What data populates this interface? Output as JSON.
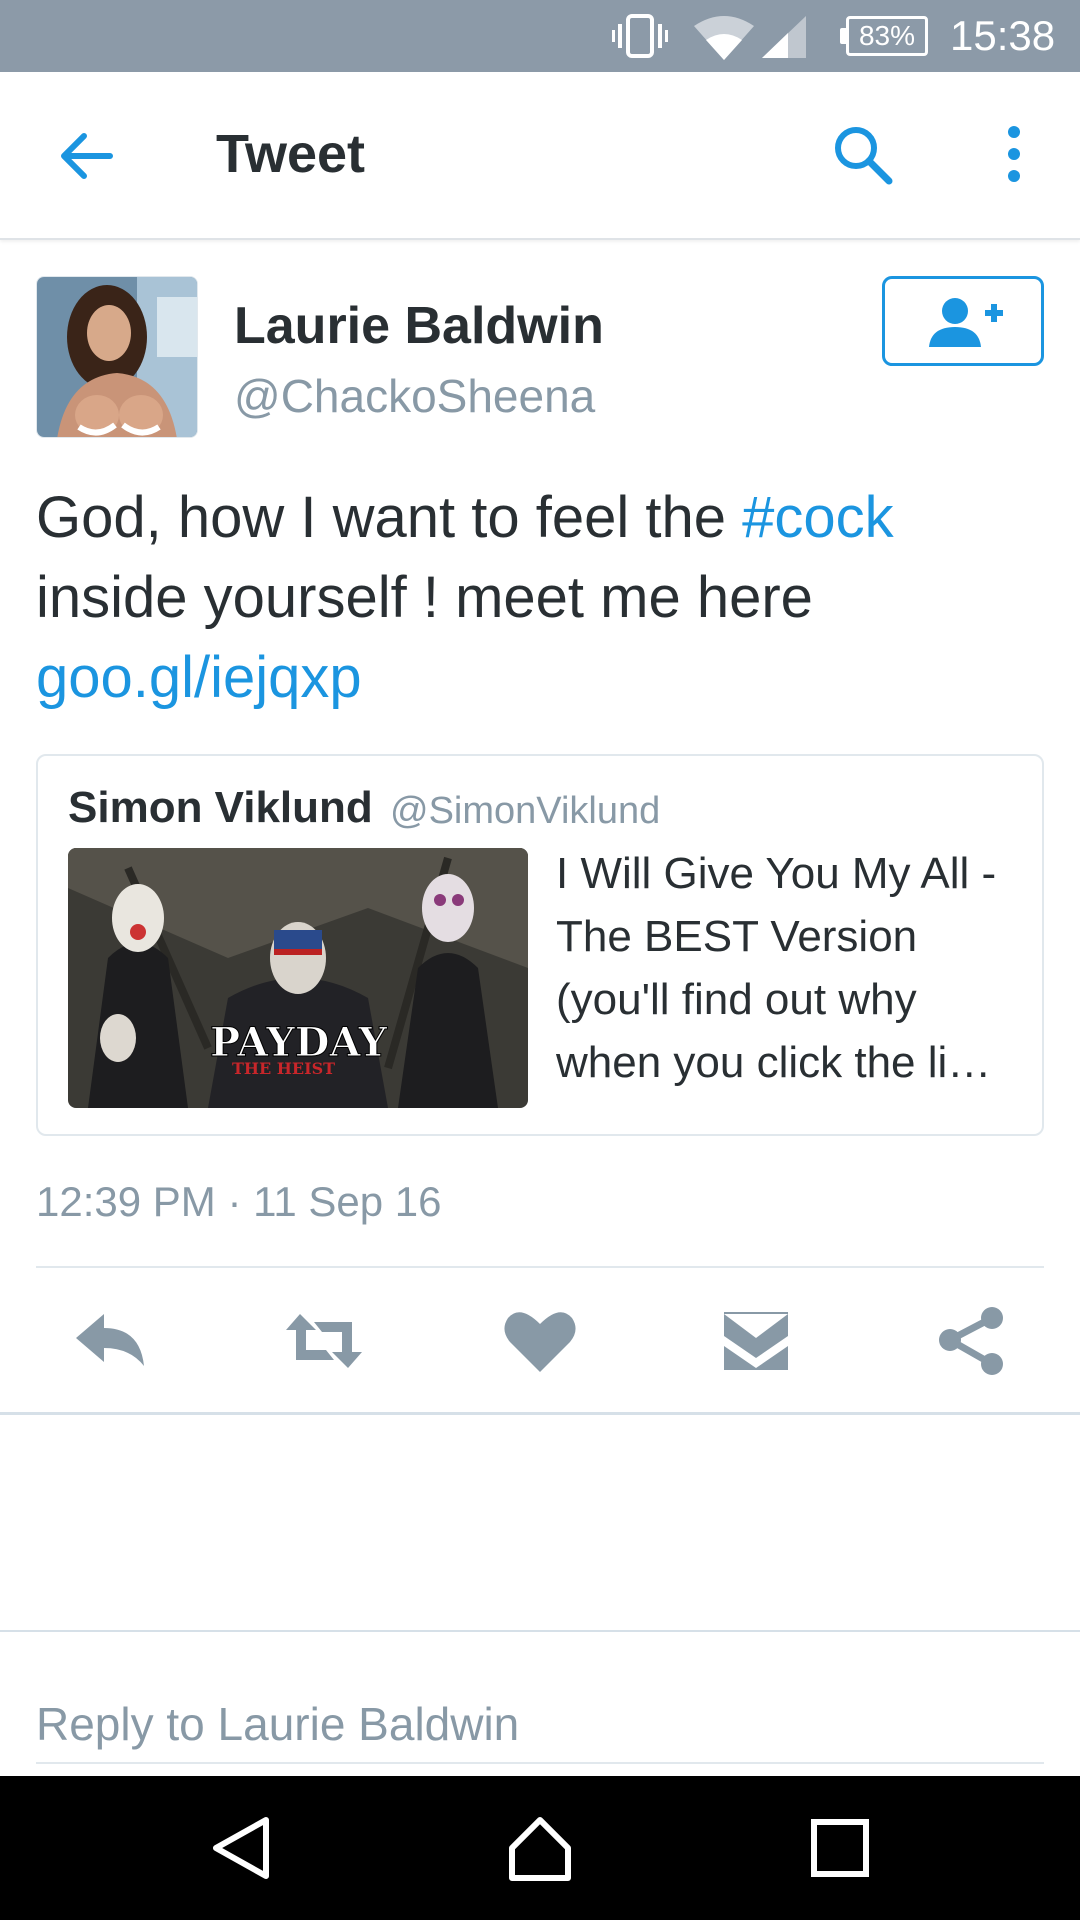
{
  "status_bar": {
    "battery": "83%",
    "time": "15:38",
    "icons": [
      "vibrate-icon",
      "wifi-icon",
      "signal-icon",
      "battery-icon"
    ]
  },
  "app_bar": {
    "title": "Tweet",
    "icons": [
      "back-arrow-icon",
      "search-icon",
      "more-vertical-icon"
    ],
    "accent": "#1b95e0"
  },
  "tweet": {
    "author_name": "Laurie Baldwin",
    "author_handle": "@ChackoSheena",
    "text_before_hashtag": "God, how I want to feel the ",
    "hashtag": "#cock",
    "text_after_hashtag": " inside yourself !  meet me here",
    "link": "goo.gl/iejqxp",
    "timestamp": "12:39 PM · 11 Sep 16",
    "follow_icon": "follow-user-icon"
  },
  "quoted_tweet": {
    "author_name": "Simon Viklund",
    "author_handle": "@SimonViklund",
    "text": "I Will Give You My All - The BEST Version (you'll find out why when you click the li…",
    "image_title": "PAYDAY",
    "image_subtitle": "THE HEIST"
  },
  "actions": [
    "reply-icon",
    "retweet-icon",
    "like-icon",
    "direct-message-icon",
    "share-icon"
  ],
  "reply": {
    "placeholder": "Reply to Laurie Baldwin"
  },
  "nav_bar": {
    "icons": [
      "back-triangle-icon",
      "home-icon",
      "recents-icon"
    ]
  },
  "colors": {
    "status_bar": "#8c9aa8",
    "link": "#1b95e0",
    "secondary_text": "#8899a6",
    "action_icon": "#8899a6",
    "primary_text": "#292f33"
  }
}
